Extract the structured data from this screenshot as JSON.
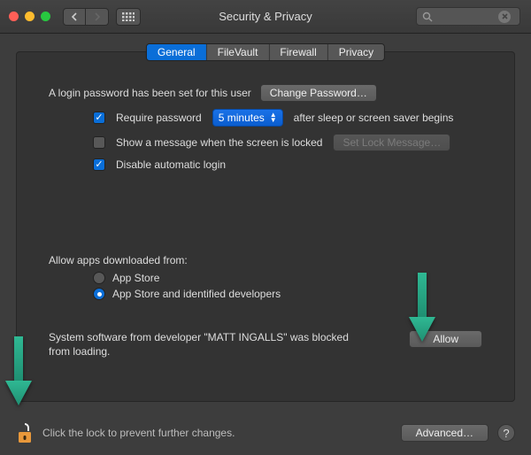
{
  "window": {
    "title": "Security & Privacy",
    "search_placeholder": ""
  },
  "tabs": [
    "General",
    "FileVault",
    "Firewall",
    "Privacy"
  ],
  "login": {
    "password_set_label": "A login password has been set for this user",
    "change_password_btn": "Change Password…",
    "require_password_label": "Require password",
    "require_password_delay": "5 minutes",
    "require_password_after": "after sleep or screen saver begins",
    "show_message_label": "Show a message when the screen is locked",
    "set_lock_message_btn": "Set Lock Message…",
    "disable_auto_login_label": "Disable automatic login"
  },
  "downloads": {
    "section_label": "Allow apps downloaded from:",
    "option_appstore": "App Store",
    "option_identified": "App Store and identified developers"
  },
  "blocked": {
    "message": "System software from developer \"MATT INGALLS\" was blocked from loading.",
    "allow_btn": "Allow"
  },
  "footer": {
    "lock_label": "Click the lock to prevent further changes.",
    "advanced_btn": "Advanced…"
  }
}
